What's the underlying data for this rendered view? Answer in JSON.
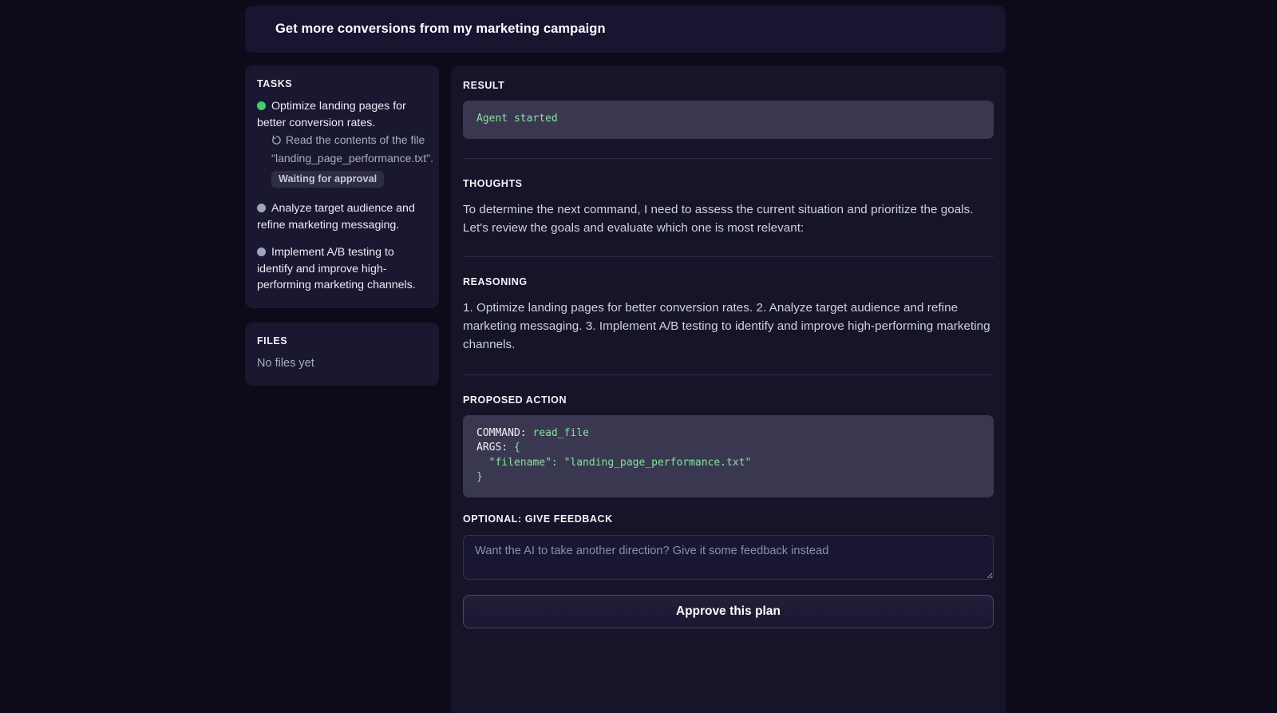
{
  "header": {
    "title": "Get more conversions from my marketing campaign"
  },
  "sidebar": {
    "tasks_label": "TASKS",
    "tasks": [
      {
        "status": "done",
        "text": "Optimize landing pages for better conversion rates.",
        "subtask": {
          "icon": "spinner-icon",
          "text": "Read the contents of the file \"landing_page_performance.txt\".",
          "badge": "Waiting for approval"
        }
      },
      {
        "status": "todo",
        "text": "Analyze target audience and refine marketing messaging."
      },
      {
        "status": "todo",
        "text": "Implement A/B testing to identify and improve high-performing marketing channels."
      }
    ],
    "files_label": "FILES",
    "files_empty": "No files yet"
  },
  "main": {
    "result_label": "RESULT",
    "result_text": "Agent started",
    "thoughts_label": "THOUGHTS",
    "thoughts_text": "To determine the next command, I need to assess the current situation and prioritize the goals. Let's review the goals and evaluate which one is most relevant:",
    "reasoning_label": "REASONING",
    "reasoning_text": "1. Optimize landing pages for better conversion rates. 2. Analyze target audience and refine marketing messaging. 3. Implement A/B testing to identify and improve high-performing marketing channels.",
    "proposed_action_label": "PROPOSED ACTION",
    "command_key": "COMMAND:",
    "command_value": "read_file",
    "args_key": "ARGS:",
    "args_open": "{",
    "args_line": "  \"filename\": \"landing_page_performance.txt\"",
    "args_close": "}",
    "feedback_label": "OPTIONAL: GIVE FEEDBACK",
    "feedback_value": "",
    "feedback_placeholder": "Want the AI to take another direction? Give it some feedback instead",
    "approve_label": "Approve this plan"
  },
  "colors": {
    "page_bg": "#0d0a1a",
    "panel_bg": "#1a1831",
    "main_bg": "#161428",
    "code_bg": "#3a3850",
    "accent_green": "#3ed06a",
    "code_green": "#86e0a0",
    "badge_bg": "#2f2d44",
    "badge_text": "#c4c7e4",
    "bullet_todo": "#9fa3bd"
  }
}
